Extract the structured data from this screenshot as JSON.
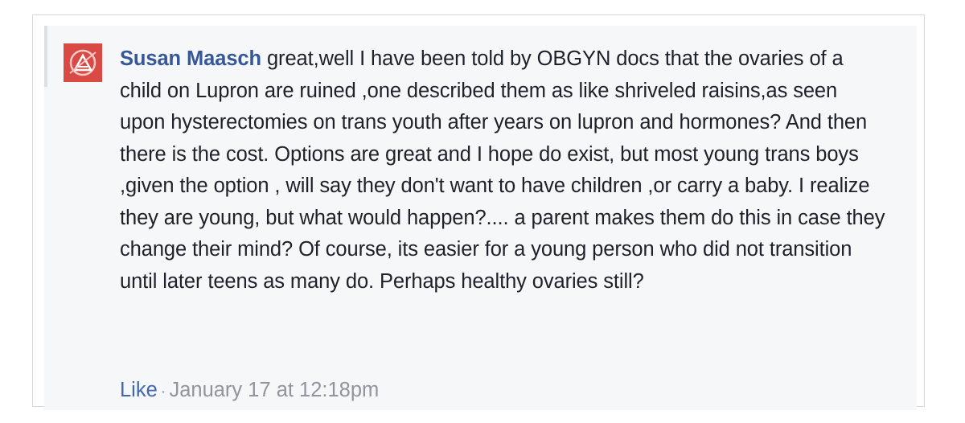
{
  "comment": {
    "author_name": "Susan Maasch",
    "body": "great,well I have been told by OBGYN docs that the ovaries of a child on Lupron are ruined ,one described them as like shriveled raisins,as seen upon hysterectomies on trans youth after years on lupron and hormones? And then there is the cost. Options are great and I hope do exist, but most young trans boys ,given the option , will say they don't want to have children ,or carry a baby. I realize they are young, but what would happen?.... a parent makes them do this in case they change their mind? Of course, its easier for a young person who did not transition until later teens as many do. Perhaps healthy ovaries still?",
    "like_label": "Like",
    "separator": "·",
    "timestamp": "January 17 at 12:18pm",
    "avatar_icon": "red-logo-avatar",
    "colors": {
      "author": "#365899",
      "like": "#4267b2",
      "meta": "#90949c",
      "background": "#f6f7f9",
      "avatar": "#d94a44"
    }
  }
}
